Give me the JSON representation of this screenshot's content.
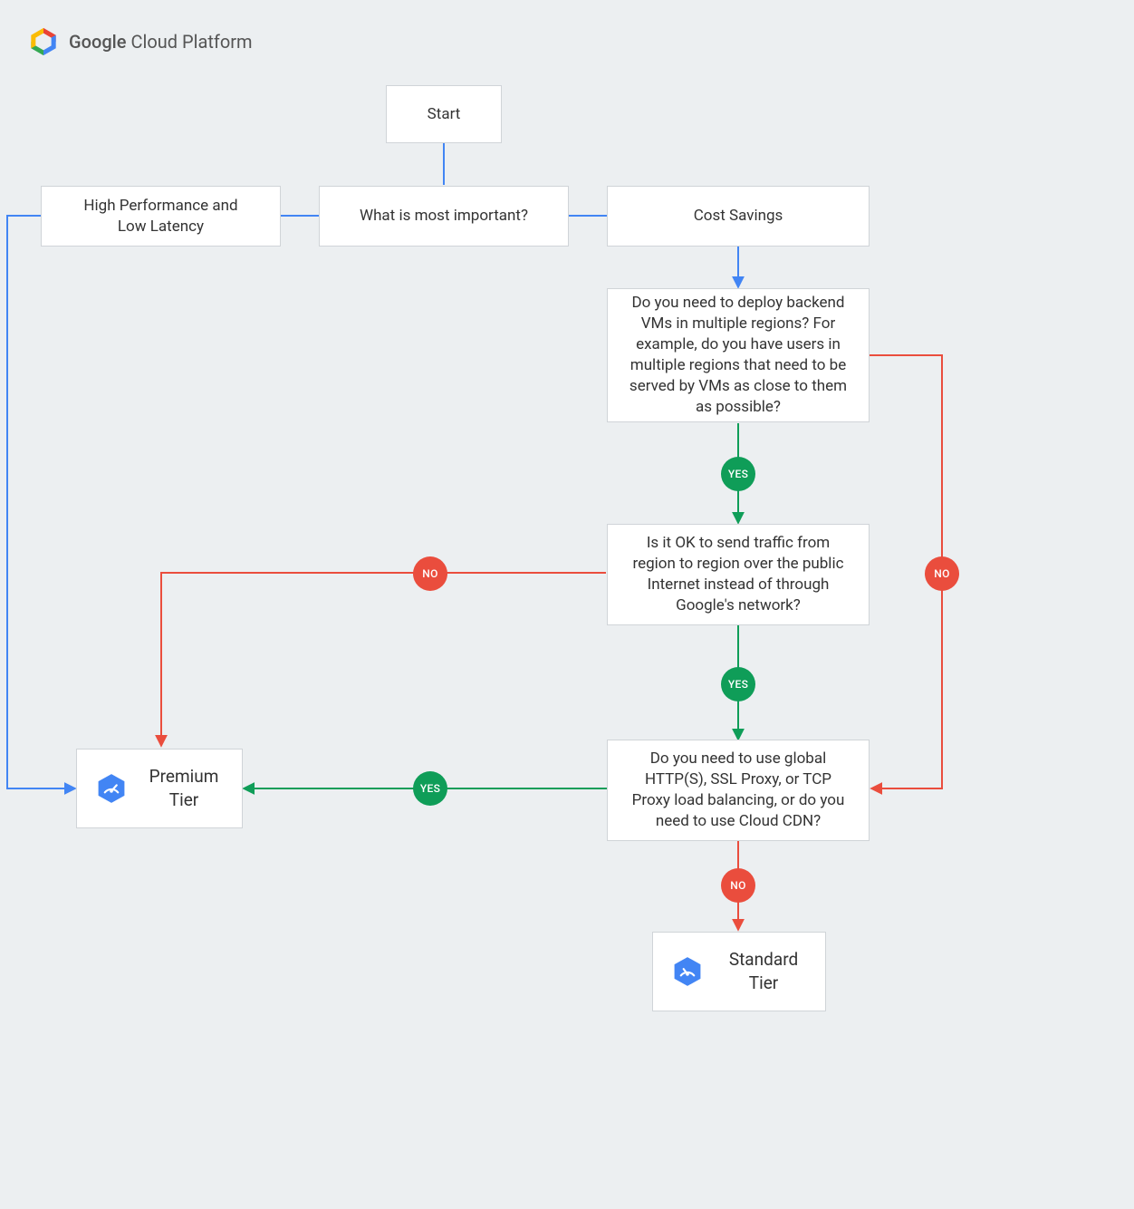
{
  "header": {
    "brand_google": "Google",
    "brand_cloud": "Cloud Platform"
  },
  "nodes": {
    "start": "Start",
    "question_main": "What is most important?",
    "option_perf": "High Performance and\nLow Latency",
    "option_cost": "Cost Savings",
    "q_regions": "Do you need to deploy backend VMs in multiple regions?\nFor example, do you have users in multiple regions that need to be served by VMs as close to them as possible?",
    "q_public_internet": "Is it OK to send traffic from region to region over the public Internet instead of through Google's network?",
    "q_global_lb": "Do you need to use global HTTP(S), SSL Proxy, or TCP Proxy load balancing, or do you need to use Cloud CDN?",
    "premium_tier": "Premium Tier",
    "standard_tier": "Standard Tier"
  },
  "badges": {
    "yes": "YES",
    "no": "NO"
  },
  "colors": {
    "blue": "#4285f4",
    "green": "#0f9d58",
    "red": "#ea4d3d"
  }
}
